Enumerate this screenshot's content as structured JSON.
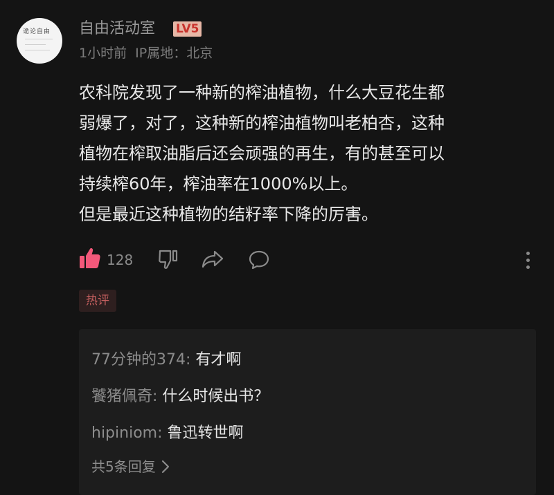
{
  "comment": {
    "avatar_text": "诡论自由",
    "username": "自由活动室",
    "level_badge": "LV5",
    "time": "1小时前",
    "ip_location": "IP属地：北京",
    "content_lines": [
      "农科院发现了一种新的榨油植物，什么大豆花生都",
      "弱爆了，对了，这种新的榨油植物叫老柏杏，这种",
      "植物在榨取油脂后还会顽强的再生，有的甚至可以",
      "持续榨60年，榨油率在1000%以上。",
      "但是最近这种植物的结籽率下降的厉害。"
    ],
    "like_count": "128",
    "hot_tag": "热评"
  },
  "replies": {
    "items": [
      {
        "name": "77分钟的374",
        "text": "有才啊"
      },
      {
        "name": "饕猪佩奇",
        "text": "什么时候出书？"
      },
      {
        "name": "hipiniom",
        "text": "鲁迅转世啊"
      }
    ],
    "total_label": "共5条回复"
  },
  "colors": {
    "background": "#141414",
    "like_icon": "#f3587a",
    "hot_tag_text": "#c45f5f",
    "level_badge_bg": "#e7b7a6",
    "level_badge_text": "#c8322c"
  },
  "icons": [
    "thumbs-up-icon",
    "thumbs-down-icon",
    "share-icon",
    "comment-icon",
    "more-icon",
    "chevron-right-icon"
  ]
}
